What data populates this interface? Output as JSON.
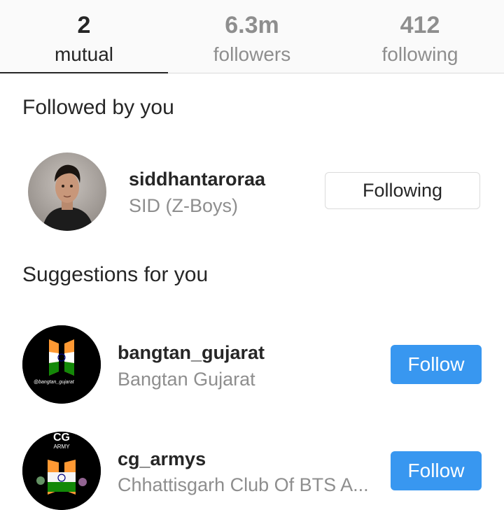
{
  "tabs": [
    {
      "count": "2",
      "label": "mutual"
    },
    {
      "count": "6.3m",
      "label": "followers"
    },
    {
      "count": "412",
      "label": "following"
    }
  ],
  "sections": {
    "followed_by_you": "Followed by you",
    "suggestions": "Suggestions for you"
  },
  "followed": {
    "username": "siddhantaroraa",
    "fullname": "SID (Z-Boys)",
    "button": "Following"
  },
  "suggestions": [
    {
      "username": "bangtan_gujarat",
      "fullname": "Bangtan Gujarat",
      "button": "Follow",
      "avatar_text": "@bangtan_gujarat"
    },
    {
      "username": "cg_armys",
      "fullname": "Chhattisgarh Club Of BTS A...",
      "button": "Follow",
      "avatar_text_top": "CG",
      "avatar_text_sub": "ARMY"
    }
  ],
  "colors": {
    "accent": "#3897f0",
    "secondary_text": "#8e8e8e",
    "primary_text": "#262626"
  }
}
